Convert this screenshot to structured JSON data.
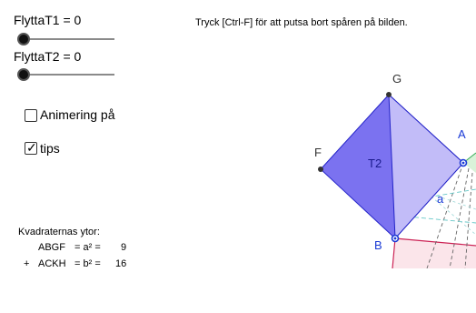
{
  "sliders": [
    {
      "label": "FlyttaT1 = 0",
      "value": 0
    },
    {
      "label": "FlyttaT2 = 0",
      "value": 0
    }
  ],
  "checkboxes": [
    {
      "label": "Animering på",
      "checked": false
    },
    {
      "label": "tips",
      "checked": true
    }
  ],
  "hint_text": "Tryck [Ctrl-F] för att putsa bort spåren på bilden.",
  "areas": {
    "title": "Kvadraternas ytor:",
    "rows": [
      {
        "prefix": "",
        "name": "ABGF",
        "formula": "= a² =",
        "value": "9"
      },
      {
        "prefix": "+",
        "name": "ACKH",
        "formula": "= b² =",
        "value": "16"
      }
    ]
  },
  "geometry_labels": {
    "G": "G",
    "F": "F",
    "A": "A",
    "B": "B",
    "T2": "T2",
    "a": "a"
  },
  "colors": {
    "square_fill": "#7b72f0",
    "triangle_fill": "#c2bcf8",
    "edge_blue": "#2323c8",
    "red_edge": "#cc2255",
    "pink_fill": "#fbe5ea",
    "green_fill": "#d9f2d9",
    "teal_dash": "#66c7c7",
    "point_blue": "#1a3ad6"
  }
}
